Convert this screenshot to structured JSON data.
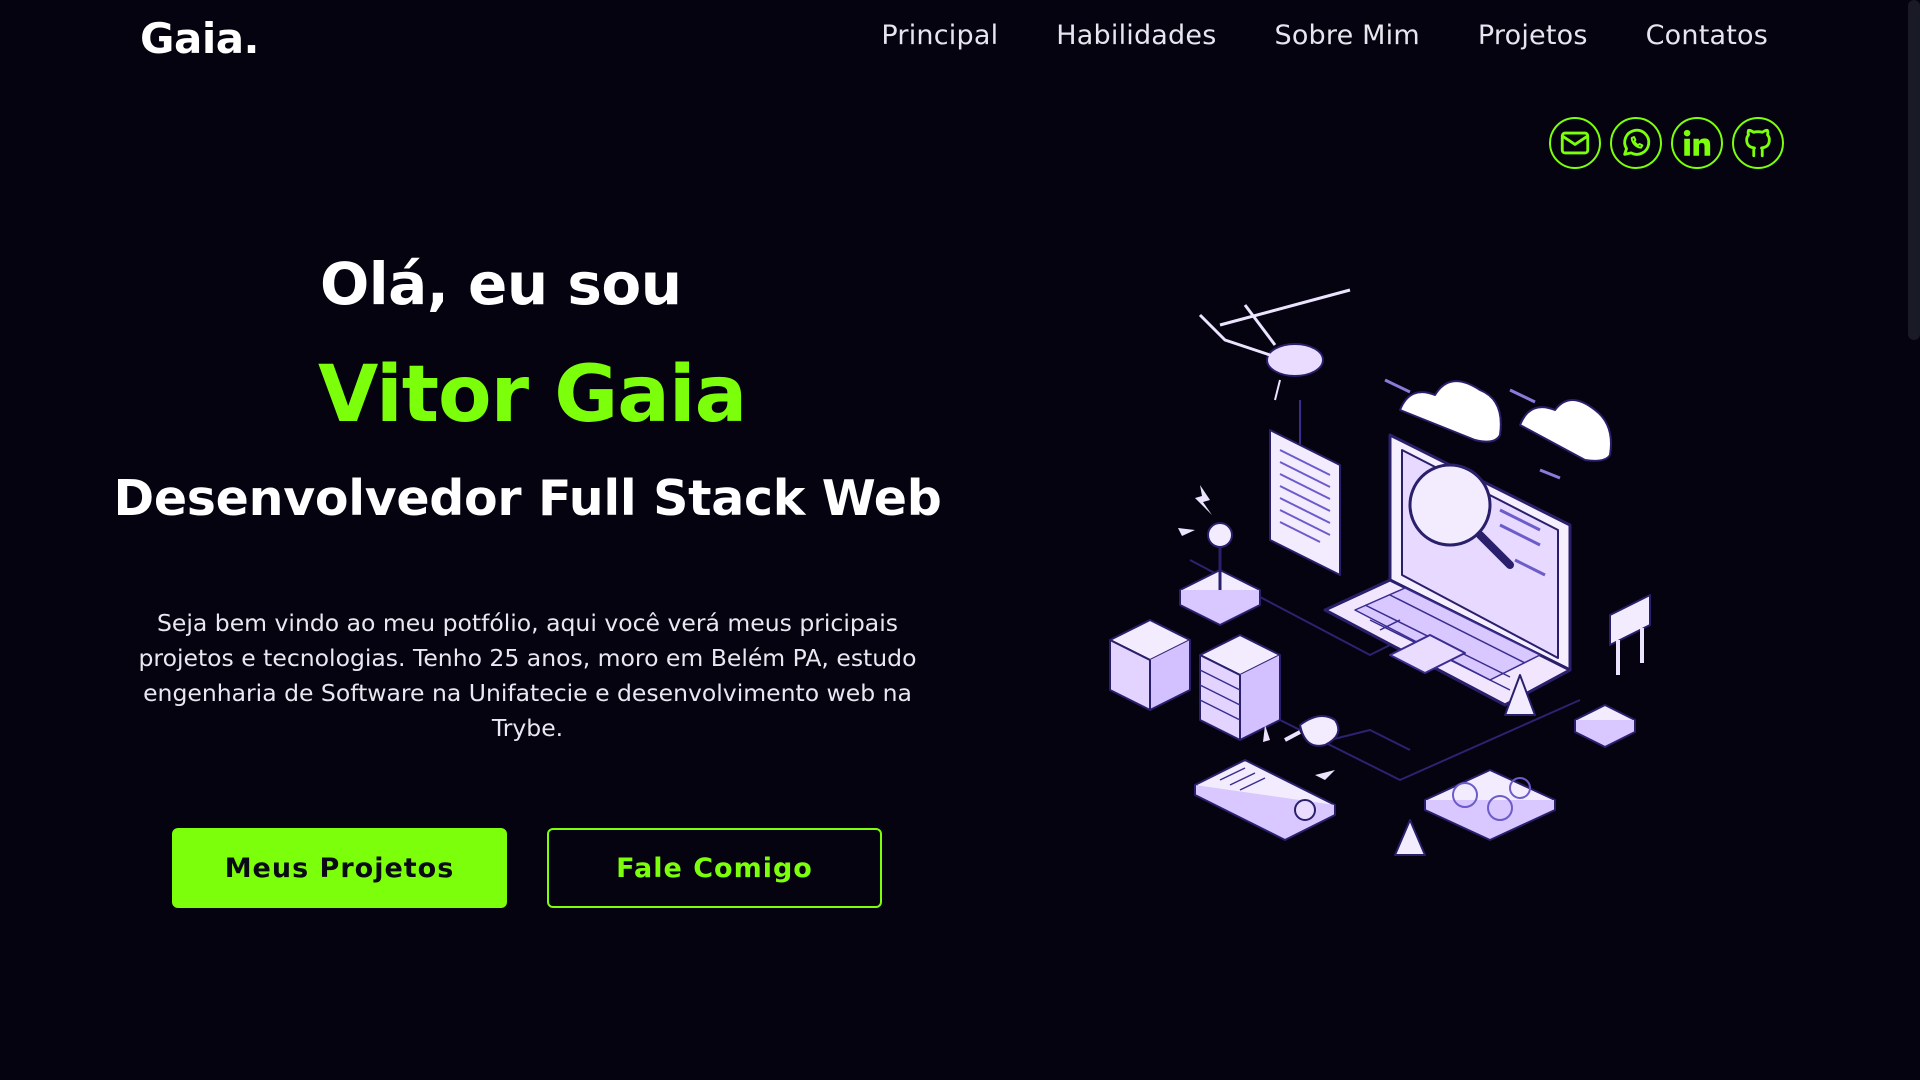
{
  "header": {
    "logo": "Gaia.",
    "nav": [
      "Principal",
      "Habilidades",
      "Sobre Mim",
      "Projetos",
      "Contatos"
    ]
  },
  "socials": [
    {
      "icon": "mail-icon"
    },
    {
      "icon": "whatsapp-icon"
    },
    {
      "icon": "linkedin-icon"
    },
    {
      "icon": "github-icon"
    }
  ],
  "hero": {
    "greeting": "Olá, eu sou",
    "name": "Vitor Gaia",
    "role": "Desenvolvedor Full Stack Web",
    "intro": "Seja bem vindo ao meu potfólio, aqui você verá meus pricipais projetos e tecnologias. Tenho 25 anos, moro em Belém PA, estudo engenharia de Software na Unifatecie e desenvolvimento web na Trybe.",
    "primary_button": "Meus Projetos",
    "secondary_button": "Fale Comigo"
  },
  "colors": {
    "background": "#04030f",
    "accent": "#7cff0a",
    "text": "#ffffff"
  }
}
